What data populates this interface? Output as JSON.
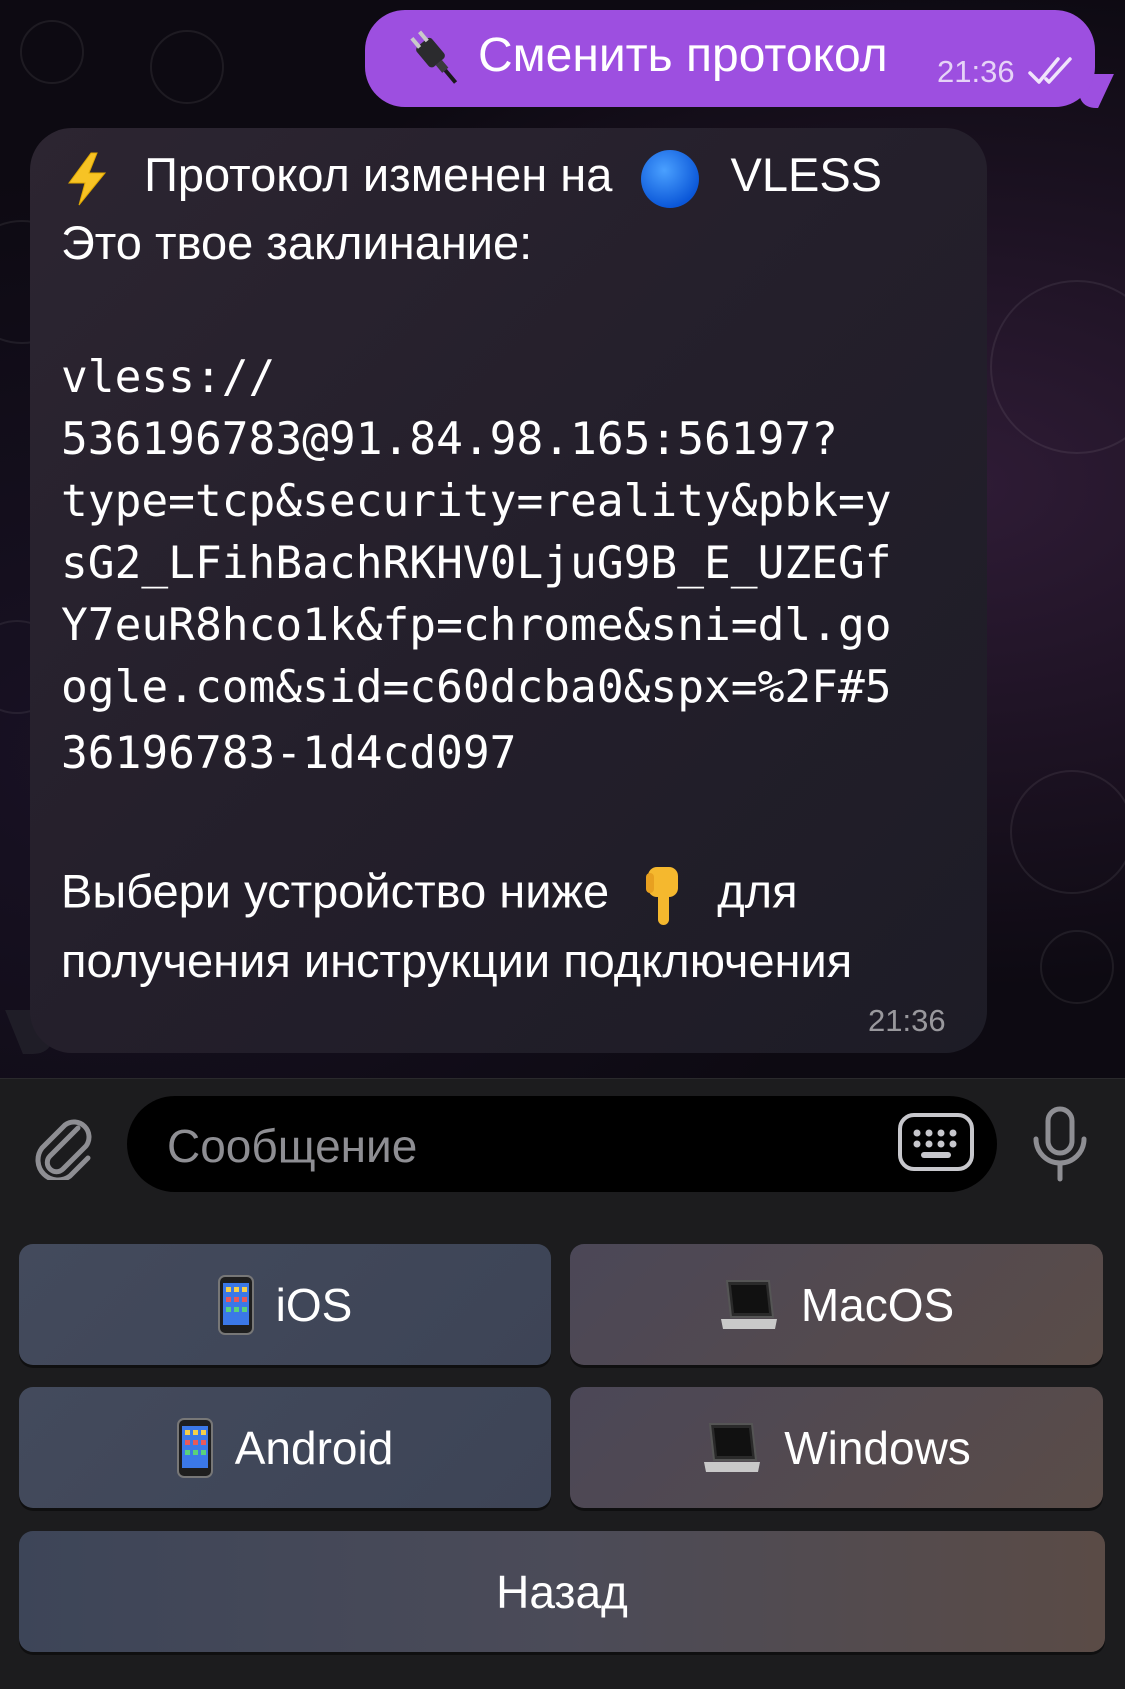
{
  "outgoing": {
    "text": "Сменить протокол",
    "time": "21:36",
    "icon": "plug-icon"
  },
  "incoming": {
    "line1_prefix": "Протокол изменен на",
    "line1_protocol": "VLESS",
    "line2": "Это твое заклинание:",
    "config_lines": [
      "vless://",
      "536196783@91.84.98.165:56197?",
      "type=tcp&security=reality&pbk=y",
      "sG2_LFihBachRKHV0LjuG9B_E_UZEGf",
      "Y7euR8hco1k&fp=chrome&sni=dl.go",
      "ogle.com&sid=c60dcba0&spx=%2F#5",
      "36196783-1d4cd097"
    ],
    "choose_prefix": "Выбери устройство ниже",
    "choose_suffix": "для",
    "choose_line2": "получения инструкции подключения",
    "time": "21:36",
    "icons": [
      "lightning-icon",
      "blue-circle-icon",
      "pointing-down-icon"
    ]
  },
  "composer": {
    "placeholder": "Сообщение"
  },
  "keyboard": {
    "buttons": [
      {
        "label": "iOS",
        "icon": "phone-icon"
      },
      {
        "label": "MacOS",
        "icon": "laptop-icon"
      },
      {
        "label": "Android",
        "icon": "phone-icon"
      },
      {
        "label": "Windows",
        "icon": "laptop-icon"
      },
      {
        "label": "Назад"
      }
    ]
  },
  "colors": {
    "outgoing_bubble": "#9d4fe0",
    "incoming_bubble": "#272330",
    "composer_bg": "#1c1c1e"
  }
}
